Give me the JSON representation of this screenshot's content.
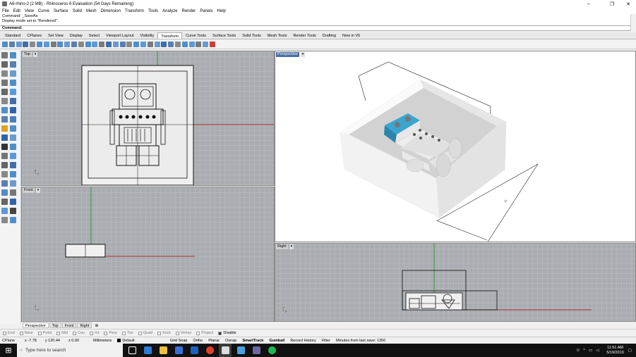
{
  "window": {
    "title": "A6-rhino-2 (2 MB) - Rhinoceros 6 Evaluation (54 Days Remaining)",
    "minimize": "–",
    "maximize": "❐",
    "close": "✕"
  },
  "menu": [
    "File",
    "Edit",
    "View",
    "Curve",
    "Surface",
    "Solid",
    "Mesh",
    "Dimension",
    "Transform",
    "Tools",
    "Analyze",
    "Render",
    "Panels",
    "Help"
  ],
  "command": {
    "history1": "Command: _SaveAs",
    "history2": "Display mode set to \"Rendered\".",
    "prompt": "Command:"
  },
  "tabs": [
    "Standard",
    "CPlanes",
    "Set View",
    "Display",
    "Select",
    "Viewport Layout",
    "Visibility",
    "Transform",
    "Curve Tools",
    "Surface Tools",
    "Solid Tools",
    "Mesh Tools",
    "Render Tools",
    "Drafting",
    "New in V6"
  ],
  "active_tab": "Transform",
  "viewports": {
    "top": "Top",
    "front": "Front",
    "perspective": "Perspective",
    "right": "Right",
    "dropdown": "▾"
  },
  "viewport_tabs": [
    "Perspective",
    "Top",
    "Front",
    "Right"
  ],
  "viewport_tab_add": "⊕",
  "osnaps": [
    {
      "label": "End",
      "on": false
    },
    {
      "label": "Near",
      "on": false
    },
    {
      "label": "Point",
      "on": false
    },
    {
      "label": "Mid",
      "on": false
    },
    {
      "label": "Cen",
      "on": false
    },
    {
      "label": "Int",
      "on": false
    },
    {
      "label": "Perp",
      "on": false
    },
    {
      "label": "Tan",
      "on": false
    },
    {
      "label": "Quad",
      "on": false
    },
    {
      "label": "Knot",
      "on": false
    },
    {
      "label": "Vertex",
      "on": false
    },
    {
      "label": "Project",
      "on": false
    },
    {
      "label": "Disable",
      "on": true
    }
  ],
  "status": {
    "cplane": "CPlane",
    "x": "x -7.78",
    "y": "y 120.44",
    "z": "z 0.00",
    "units": "Millimeters",
    "layer": "Default",
    "grid_snap": "Grid Snap",
    "ortho": "Ortho",
    "planar": "Planar",
    "osnap": "Osnap",
    "smarttrack": "SmartTrack",
    "gumball": "Gumball",
    "record_history": "Record History",
    "filter": "Filter",
    "save_info": "Minutes from last save: 1350"
  },
  "taskbar": {
    "search": "Type here to search",
    "time": "11:51 AM",
    "date": "5/19/2019"
  },
  "colors": {
    "x_axis": "#b03030",
    "y_axis": "#2a9a2a",
    "active_label": "#4a6fa5",
    "teal_part": "#3aa5d0"
  }
}
